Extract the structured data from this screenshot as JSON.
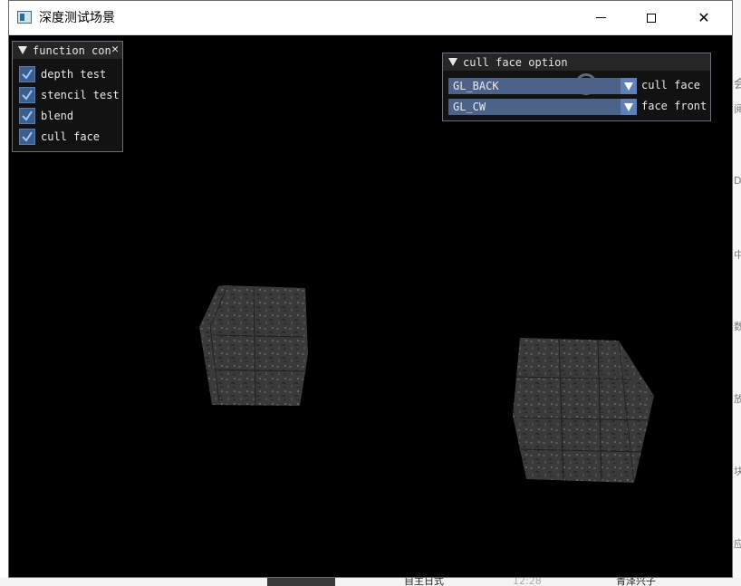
{
  "window": {
    "title": "深度测试场景",
    "controls": {
      "minimize": "—",
      "maximize": "☐",
      "close": "✕"
    }
  },
  "function_panel": {
    "title": "function con",
    "close_glyph": "✕",
    "items": [
      {
        "label": "depth test",
        "checked": true
      },
      {
        "label": "stencil test",
        "checked": true
      },
      {
        "label": "blend",
        "checked": true
      },
      {
        "label": "cull face",
        "checked": true
      }
    ]
  },
  "cull_panel": {
    "title": "cull face option",
    "combos": [
      {
        "value": "GL_BACK",
        "label": "cull face"
      },
      {
        "value": "GL_CW",
        "label": "face front"
      }
    ]
  },
  "taskbar": {
    "item1": "自主日式",
    "item2": "12:28",
    "item3": "青泽兴子"
  },
  "background_fragments": [
    "会",
    "阅",
    "D_",
    "中",
    "数",
    "放",
    "块",
    "应"
  ],
  "colors": {
    "checkbox_fill": "#3d5e8c",
    "combo_fill": "#4c6289",
    "panel_bg": "#141414",
    "cube_texture": "#3a3a3a"
  }
}
